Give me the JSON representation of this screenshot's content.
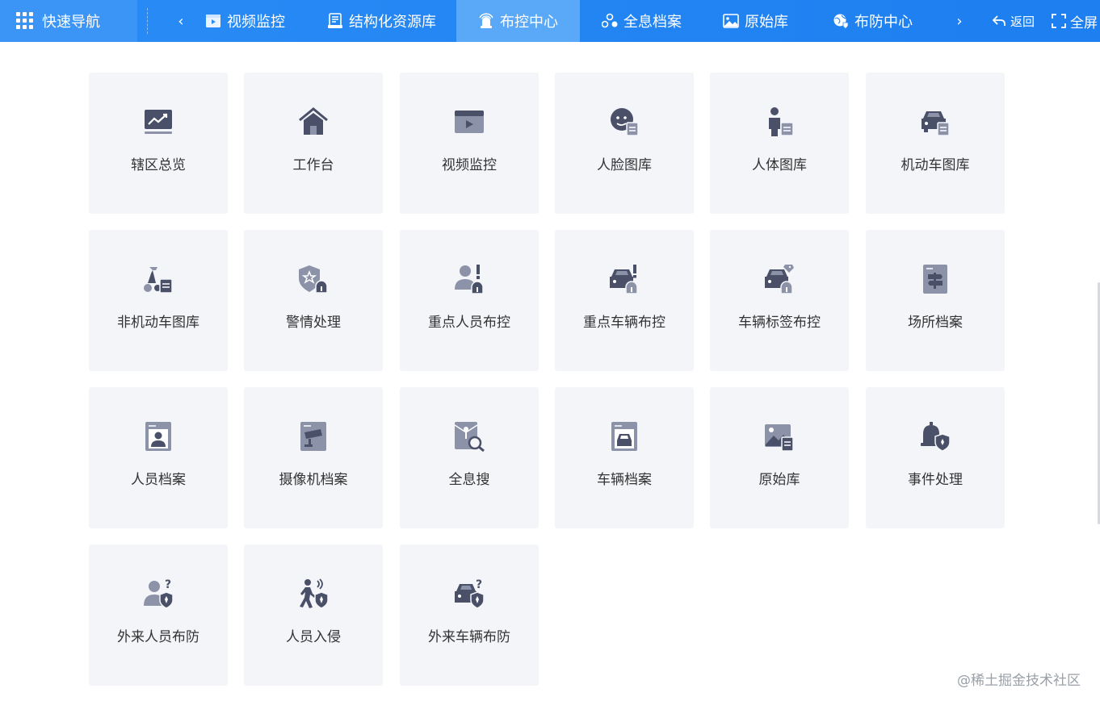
{
  "topbar": {
    "quick_nav_label": "快速导航",
    "prev_arrow": "‹",
    "next_arrow": "›",
    "tabs": [
      {
        "label": "视频监控",
        "icon": "video-monitor-icon"
      },
      {
        "label": "结构化资源库",
        "icon": "structured-library-icon"
      },
      {
        "label": "布控中心",
        "icon": "alarm-light-icon",
        "active": true
      },
      {
        "label": "全息档案",
        "icon": "hologram-archive-icon"
      },
      {
        "label": "原始库",
        "icon": "original-library-icon"
      },
      {
        "label": "布防中心",
        "icon": "defense-globe-icon"
      }
    ],
    "back_label": "返回",
    "fullscreen_label": "全屏"
  },
  "cards": [
    {
      "label": "辖区总览",
      "icon": "trend-chart-icon"
    },
    {
      "label": "工作台",
      "icon": "home-icon"
    },
    {
      "label": "视频监控",
      "icon": "video-play-icon"
    },
    {
      "label": "人脸图库",
      "icon": "face-library-icon"
    },
    {
      "label": "人体图库",
      "icon": "body-library-icon"
    },
    {
      "label": "机动车图库",
      "icon": "vehicle-library-icon"
    },
    {
      "label": "非机动车图库",
      "icon": "scooter-library-icon"
    },
    {
      "label": "警情处理",
      "icon": "police-shield-alarm-icon"
    },
    {
      "label": "重点人员布控",
      "icon": "key-person-alarm-icon"
    },
    {
      "label": "重点车辆布控",
      "icon": "key-vehicle-alarm-icon"
    },
    {
      "label": "车辆标签布控",
      "icon": "vehicle-tag-alarm-icon"
    },
    {
      "label": "场所档案",
      "icon": "place-archive-icon"
    },
    {
      "label": "人员档案",
      "icon": "person-archive-icon"
    },
    {
      "label": "摄像机档案",
      "icon": "camera-archive-icon"
    },
    {
      "label": "全息搜",
      "icon": "hologram-search-icon"
    },
    {
      "label": "车辆档案",
      "icon": "vehicle-archive-icon"
    },
    {
      "label": "原始库",
      "icon": "image-library-icon"
    },
    {
      "label": "事件处理",
      "icon": "bell-shield-icon"
    },
    {
      "label": "外来人员布防",
      "icon": "stranger-person-shield-icon"
    },
    {
      "label": "人员入侵",
      "icon": "person-intrusion-icon"
    },
    {
      "label": "外来车辆布防",
      "icon": "stranger-vehicle-shield-icon"
    }
  ],
  "watermark": "@稀土掘金技术社区",
  "colors": {
    "topbar": "#1d7ff0",
    "active_tab": "#5aa9f8",
    "card_bg": "#f3f5f9",
    "icon_dark": "#4a5068",
    "icon_light": "#8c92a8"
  }
}
